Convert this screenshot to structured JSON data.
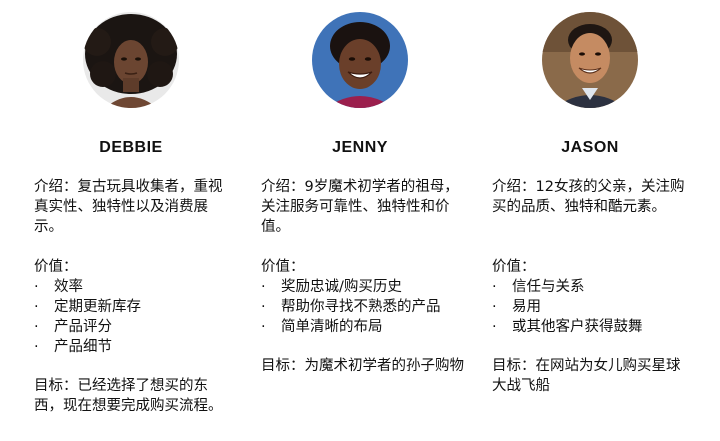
{
  "personas": [
    {
      "name": "DEBBIE",
      "intro": "介绍：复古玩具收集者，重视真实性、独特性以及消费展示。",
      "values_label": "价值：",
      "values": [
        "效率",
        "定期更新库存",
        "产品评分",
        "产品细节"
      ],
      "goal": "目标：已经选择了想买的东西，现在想要完成购买流程。",
      "avatar_icon": "woman-curly-hair-photo"
    },
    {
      "name": "JENNY",
      "intro": "介绍：9岁魔术初学者的祖母，关注服务可靠性、独特性和价值。",
      "values_label": "价值：",
      "values": [
        "奖励忠诚/购买历史",
        "帮助你寻找不熟悉的产品",
        "简单清晰的布局"
      ],
      "goal": "目标：为魔术初学者的孙子购物",
      "avatar_icon": "smiling-woman-photo"
    },
    {
      "name": "JASON",
      "intro": "介绍：12女孩的父亲，关注购买的品质、独特和酷元素。",
      "values_label": "价值：",
      "values": [
        "信任与关系",
        "易用",
        "或其他客户获得鼓舞"
      ],
      "goal": "目标：在网站为女儿购买星球大战飞船",
      "avatar_icon": "smiling-man-photo"
    }
  ],
  "bullet_char": "·",
  "colors": {
    "text": "#111111",
    "background": "#ffffff"
  }
}
